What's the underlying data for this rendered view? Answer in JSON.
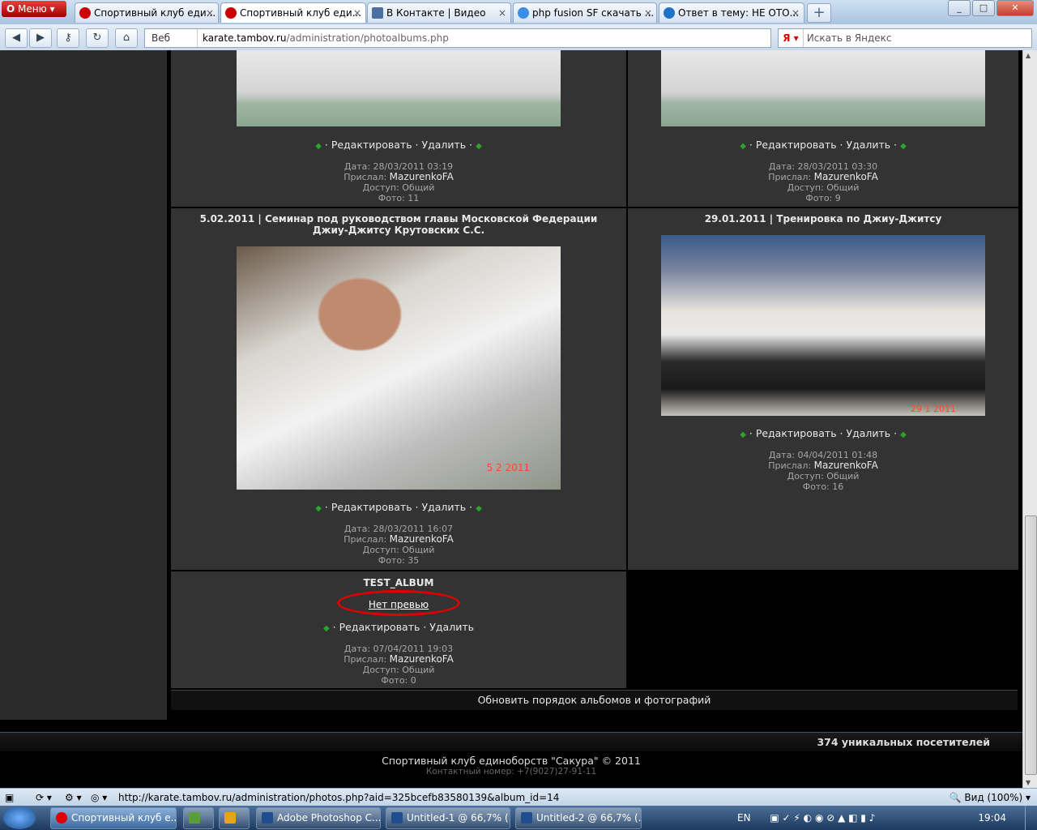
{
  "browser": {
    "menu_label": "Меню",
    "tabs": [
      {
        "title": "Спортивный клуб еди...",
        "active": false
      },
      {
        "title": "Спортивный клуб еди...",
        "active": true
      },
      {
        "title": "В Контакте | Видео",
        "active": false
      },
      {
        "title": "php fusion SF скачать ...",
        "active": false
      },
      {
        "title": "Ответ в тему: НЕ ОТО...",
        "active": false
      }
    ],
    "address_prefix": "Веб",
    "address_host": "karate.tambov.ru",
    "address_path": "/administration/photoalbums.php",
    "search_placeholder": "Искать в Яндекс",
    "status_url": "http://karate.tambov.ru/administration/photos.php?aid=325bcefb83580139&album_id=14",
    "zoom": "Вид (100%)"
  },
  "albums": [
    {
      "edit": "Редактировать",
      "delete": "Удалить",
      "date": "Дата: 28/03/2011 03:19",
      "sender_label": "Прислал:",
      "author": "MazurenkoFA",
      "access": "Доступ: Общий",
      "photos": "Фото: 11"
    },
    {
      "edit": "Редактировать",
      "delete": "Удалить",
      "date": "Дата: 28/03/2011 03:30",
      "sender_label": "Прислал:",
      "author": "MazurenkoFA",
      "access": "Доступ: Общий",
      "photos": "Фото: 9"
    },
    {
      "title": "5.02.2011 | Семинар под руководством главы Московской Федерации Джиу-Джитсу Крутовских С.С.",
      "edit": "Редактировать",
      "delete": "Удалить",
      "date": "Дата: 28/03/2011 16:07",
      "sender_label": "Прислал:",
      "author": "MazurenkoFA",
      "access": "Доступ: Общий",
      "photos": "Фото: 35",
      "photo_stamp": "5 2 2011"
    },
    {
      "title": "29.01.2011 | Тренировка по Джиу-Джитсу",
      "edit": "Редактировать",
      "delete": "Удалить",
      "date": "Дата: 04/04/2011 01:48",
      "sender_label": "Прислал:",
      "author": "MazurenkoFA",
      "access": "Доступ: Общий",
      "photos": "Фото: 16",
      "photo_stamp": "29 1 2011"
    },
    {
      "title": "TEST_ALBUM",
      "no_preview": "Нет превью",
      "edit": "Редактировать",
      "delete": "Удалить",
      "date": "Дата: 07/04/2011 19:03",
      "sender_label": "Прислал:",
      "author": "MazurenkoFA",
      "access": "Доступ: Общий",
      "photos": "Фото: 0"
    }
  ],
  "update_order": "Обновить порядок альбомов и фотографий",
  "footer": {
    "visitors": "374 уникальных посетителей",
    "copyright": "Спортивный клуб единоборств \"Сакура\" © 2011",
    "contact": "Контактный номер: +7(9027)27-91-11"
  },
  "taskbar": {
    "items": [
      "Спортивный клуб е...",
      "Adobe Photoshop C...",
      "Untitled-1 @ 66,7% (...",
      "Untitled-2 @ 66,7% (..."
    ],
    "lang": "EN",
    "time": "19:04"
  }
}
